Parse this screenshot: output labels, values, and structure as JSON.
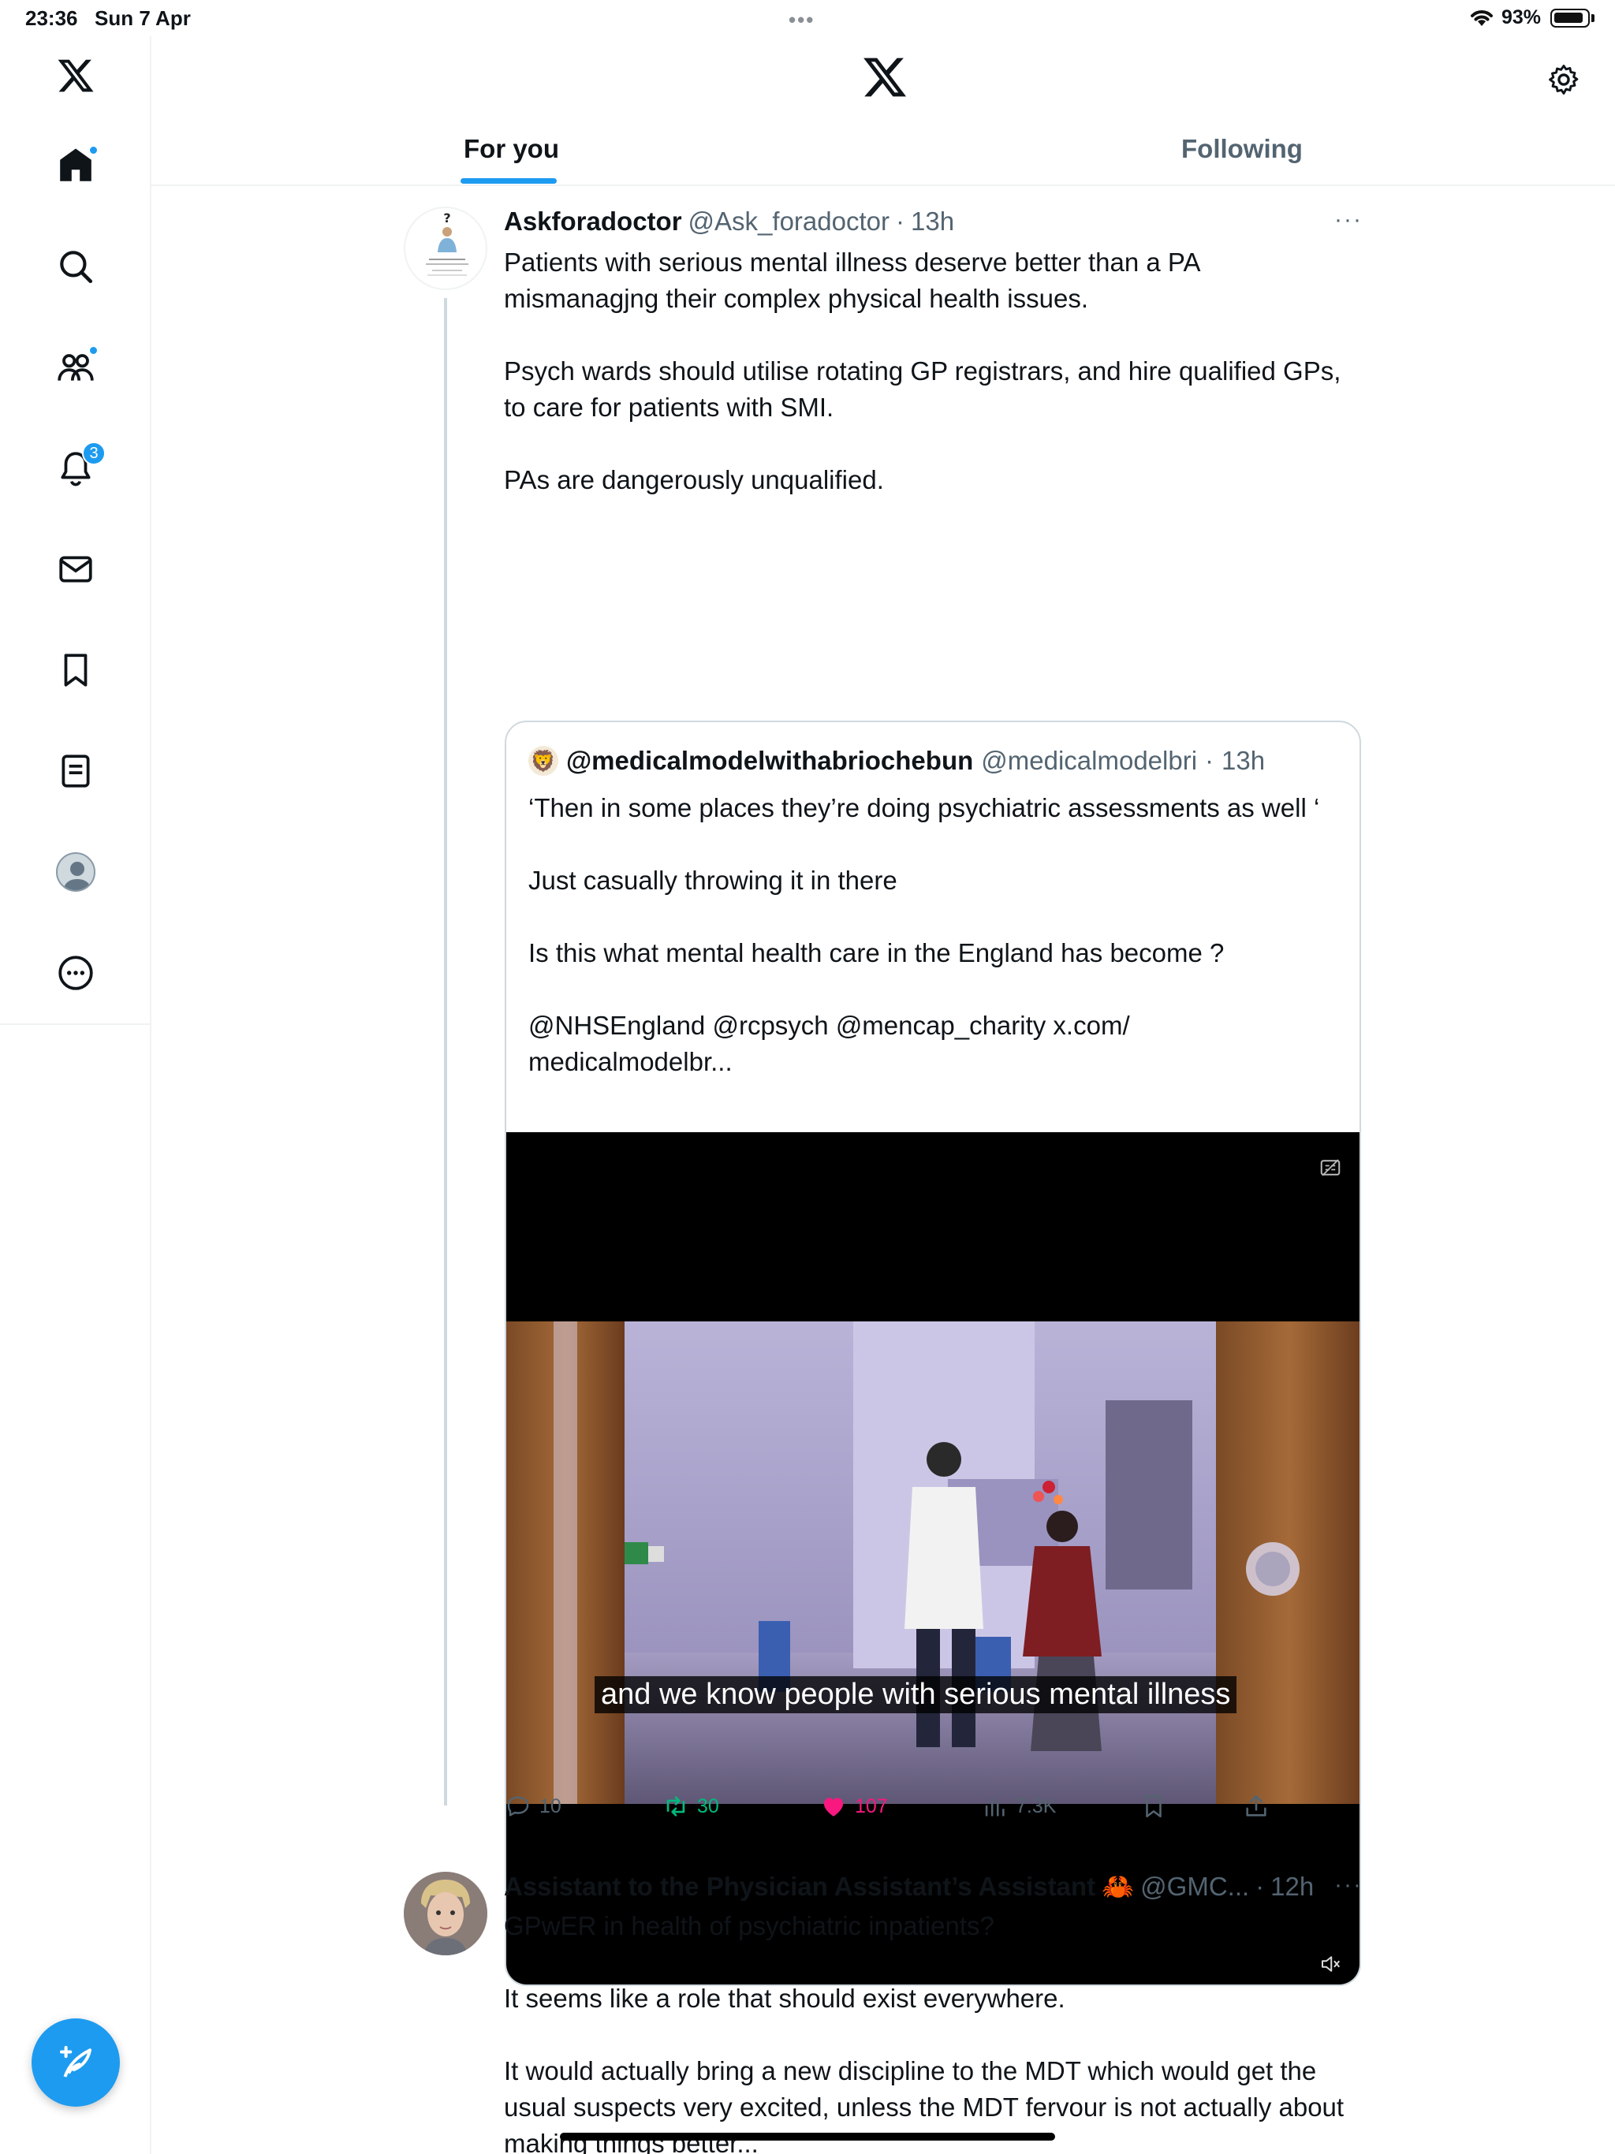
{
  "status_bar": {
    "time": "23:36",
    "date": "Sun 7 Apr",
    "battery": "93%",
    "battery_level": 0.93
  },
  "sidebar": {
    "items": [
      {
        "icon": "x-logo-icon"
      },
      {
        "icon": "home-icon",
        "dot": true
      },
      {
        "icon": "search-icon"
      },
      {
        "icon": "communities-icon",
        "dot": true
      },
      {
        "icon": "notifications-icon",
        "badge": "3"
      },
      {
        "icon": "messages-icon"
      },
      {
        "icon": "bookmark-icon"
      },
      {
        "icon": "lists-icon"
      },
      {
        "icon": "profile-avatar-icon"
      },
      {
        "icon": "more-icon"
      }
    ],
    "compose_icon": "compose-feather-icon"
  },
  "header": {
    "logo": "x-logo-icon",
    "settings_icon": "gear-icon",
    "tabs": [
      {
        "label": "For you",
        "active": true
      },
      {
        "label": "Following",
        "active": false
      }
    ]
  },
  "tweets": [
    {
      "display_name": "Askforadoctor",
      "handle": "@Ask_foradoctor",
      "separator": "·",
      "time": "13h",
      "more": "···",
      "paragraphs": [
        "Patients with serious mental illness deserve better than a PA mismanagjng their complex physical health issues.",
        "Psych wards should utilise rotating GP registrars, and hire qualified GPs, to care for patients with SMI.",
        "PAs are dangerously unqualified."
      ],
      "quote": {
        "display_name": "@medicalmodelwithabriochebun",
        "handle": "@medicalmodelbri",
        "separator": "·",
        "time": "13h",
        "paragraphs": [
          "‘Then in some places they’re doing psychiatric assessments as well ‘",
          "Just casually throwing it in there",
          "Is this what mental health care in the England has become ?",
          "@NHSEngland @rcpsych @mencap_charity x.com/ medicalmodelbr..."
        ],
        "video_caption": "and we know people with serious mental illness"
      },
      "actions": {
        "replies": "10",
        "retweets": "30",
        "likes": "107",
        "views": "7.3K"
      }
    },
    {
      "display_name": "Assistant to the Physician Assistant’s Assistant",
      "name_emoji": "🦀",
      "handle": "@GMC...",
      "separator": "·",
      "time": "12h",
      "more": "···",
      "paragraphs": [
        "GPwER in health of psychiatric inpatients?",
        "It seems like a role that should exist everywhere.",
        "It would actually bring a new discipline to the MDT which would get the usual suspects very excited, unless the MDT fervour is not actually about making things better..."
      ]
    }
  ],
  "colors": {
    "accent": "#1d9bf0",
    "retweet": "#00ba7c",
    "like": "#f91880",
    "muted": "#536471"
  }
}
